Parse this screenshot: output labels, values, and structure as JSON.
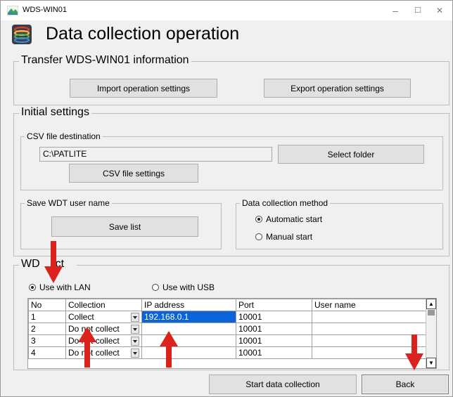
{
  "window": {
    "title": "WDS-WIN01",
    "minimize": "–",
    "maximize": "☐",
    "close": "✕"
  },
  "heading": "Data collection operation",
  "transfer": {
    "title": "Transfer WDS-WIN01 information",
    "import_label": "Import operation settings",
    "export_label": "Export operation settings"
  },
  "initial": {
    "title": "Initial settings",
    "csv": {
      "title": "CSV file destination",
      "path": "C:\\PATLITE",
      "select_folder_label": "Select folder",
      "csv_settings_label": "CSV file settings"
    },
    "wdt": {
      "title": "Save WDT user name",
      "save_list_label": "Save list"
    },
    "method": {
      "title": "Data collection method",
      "automatic_label": "Automatic start",
      "manual_label": "Manual start",
      "selected": "automatic"
    }
  },
  "wdt_list": {
    "title_left": "WD",
    "title_right": "ct",
    "lan_label": "Use with LAN",
    "usb_label": "Use with USB",
    "selected": "lan",
    "columns": [
      "No",
      "Collection",
      "IP address",
      "Port",
      "User name"
    ],
    "rows": [
      {
        "no": "1",
        "collection": "Collect",
        "ip": "192.168.0.1",
        "port": "10001",
        "user": ""
      },
      {
        "no": "2",
        "collection": "Do not collect",
        "ip": "",
        "port": "10001",
        "user": ""
      },
      {
        "no": "3",
        "collection": "Do not collect",
        "ip": "",
        "port": "10001",
        "user": ""
      },
      {
        "no": "4",
        "collection": "Do not collect",
        "ip": "",
        "port": "10001",
        "user": ""
      }
    ]
  },
  "footer": {
    "start_label": "Start data collection",
    "back_label": "Back"
  },
  "colors": {
    "annotation_arrow": "#d9231c",
    "selection": "#0a64d8"
  }
}
